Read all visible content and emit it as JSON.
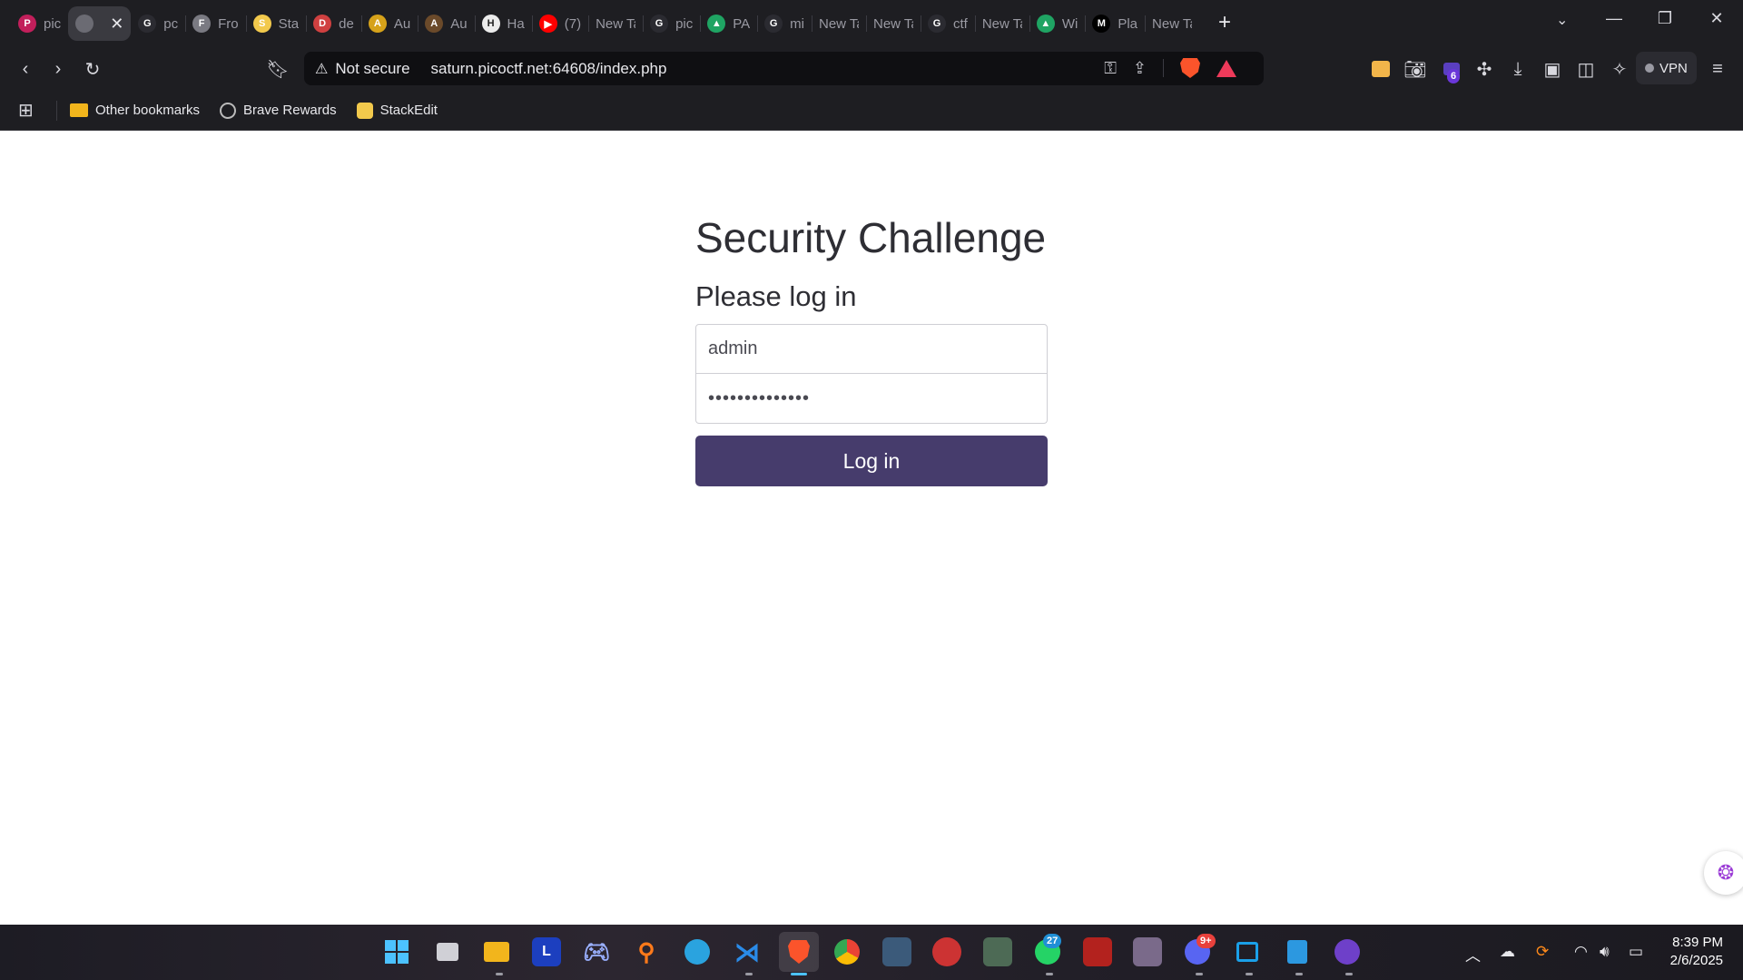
{
  "browser": {
    "tabs": [
      {
        "title": "pic",
        "favicon": "picoctf-icon",
        "color": "#c21f5b",
        "glyph": "P"
      },
      {
        "title": "",
        "favicon": "globe-icon",
        "color": "#6b6b73",
        "glyph": "",
        "active": true
      },
      {
        "title": "pc",
        "favicon": "github-icon",
        "color": "#2b2b31",
        "glyph": "G"
      },
      {
        "title": "Fro",
        "favicon": "frog-icon",
        "color": "#7a7a82",
        "glyph": "F"
      },
      {
        "title": "Sta",
        "favicon": "stackedit-icon",
        "color": "#f2c94c",
        "glyph": "S"
      },
      {
        "title": "de",
        "favicon": "shield-icon",
        "color": "#d04040",
        "glyph": "D"
      },
      {
        "title": "Au",
        "favicon": "autopsy-icon",
        "color": "#d6a21a",
        "glyph": "A"
      },
      {
        "title": "Au",
        "favicon": "spider-icon",
        "color": "#6b4a2a",
        "glyph": "A"
      },
      {
        "title": "Ha",
        "favicon": "openai-icon",
        "color": "#ececec",
        "glyph": "H"
      },
      {
        "title": "(7)",
        "favicon": "youtube-icon",
        "color": "#ff0000",
        "glyph": "▶"
      },
      {
        "title": "New Ta",
        "favicon": "",
        "color": "",
        "glyph": ""
      },
      {
        "title": "pic",
        "favicon": "github-icon",
        "color": "#2b2b31",
        "glyph": "G"
      },
      {
        "title": "PA",
        "favicon": "drive-icon",
        "color": "#1fa463",
        "glyph": "▲"
      },
      {
        "title": "mi",
        "favicon": "github-icon",
        "color": "#2b2b31",
        "glyph": "G"
      },
      {
        "title": "New Ta",
        "favicon": "",
        "color": "",
        "glyph": ""
      },
      {
        "title": "New Ta",
        "favicon": "",
        "color": "",
        "glyph": ""
      },
      {
        "title": "ctf",
        "favicon": "github-icon",
        "color": "#2b2b31",
        "glyph": "G"
      },
      {
        "title": "New Ta",
        "favicon": "",
        "color": "",
        "glyph": ""
      },
      {
        "title": "Wi",
        "favicon": "drive-icon",
        "color": "#1fa463",
        "glyph": "▲"
      },
      {
        "title": "Pla",
        "favicon": "medium-icon",
        "color": "#000000",
        "glyph": "M"
      },
      {
        "title": "New Ta",
        "favicon": "",
        "color": "",
        "glyph": ""
      }
    ],
    "address": {
      "security_label": "Not secure",
      "url": "saturn.picoctf.net:64608/index.php"
    },
    "extension_badge": "6",
    "vpn_label": "VPN",
    "bookmarks": [
      {
        "label": "Other bookmarks",
        "icon": "folder-icon"
      },
      {
        "label": "Brave Rewards",
        "icon": "brave-rewards-icon"
      },
      {
        "label": "StackEdit",
        "icon": "stackedit-icon"
      }
    ]
  },
  "page": {
    "title": "Security Challenge",
    "subtitle": "Please log in",
    "username_value": "admin",
    "password_value": "••••••••••••••",
    "login_button": "Log in"
  },
  "taskbar": {
    "whatsapp_badge": "27",
    "discord_badge": "9+",
    "time": "8:39 PM",
    "date": "2/6/2025"
  },
  "colors": {
    "browser_chrome": "#1e1e22",
    "login_button": "#463c6c",
    "brave_orange": "#fb542b"
  }
}
